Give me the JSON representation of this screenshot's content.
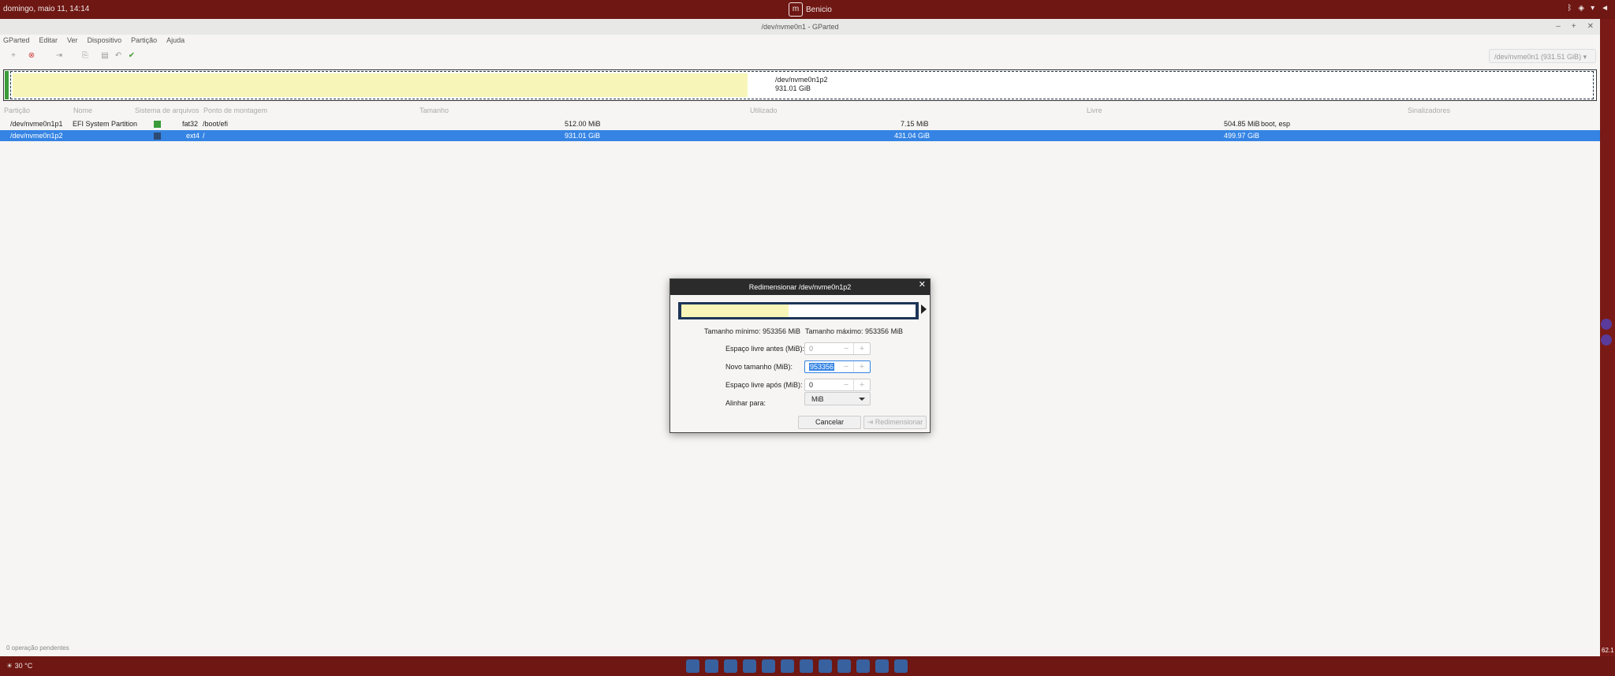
{
  "topbar": {
    "clock": "domingo, maio 11, 14:14",
    "user": "Benicio",
    "icons": [
      "mint-logo-icon",
      "bluetooth-icon",
      "shield-icon",
      "network-icon",
      "volume-icon"
    ]
  },
  "window": {
    "title": "/dev/nvme0n1 - GParted",
    "controls": [
      "minimize-icon",
      "maximize-icon",
      "close-icon"
    ]
  },
  "menu": [
    "GParted",
    "Editar",
    "Ver",
    "Dispositivo",
    "Partição",
    "Ajuda"
  ],
  "toolbar": {
    "icons": [
      "new-icon",
      "delete-icon",
      "resize-icon",
      "copy-icon",
      "paste-icon",
      "undo-icon",
      "apply-icon"
    ],
    "device": "/dev/nvme0n1 (931.51 GiB)"
  },
  "map": {
    "label_name": "/dev/nvme0n1p2",
    "label_size": "931.01 GiB"
  },
  "table": {
    "headers": [
      "Partição",
      "Nome",
      "Sistema de arquivos",
      "Ponto de montagem",
      "Tamanho",
      "Utilizado",
      "Livre",
      "Sinalizadores"
    ],
    "rows": [
      {
        "partition": "/dev/nvme0n1p1",
        "name": "EFI System Partition",
        "fs": "fat32",
        "fs_color": "#3a9b39",
        "mount": "/boot/efi",
        "size": "512.00 MiB",
        "used": "7.15 MiB",
        "free": "504.85 MiB",
        "flags": "boot, esp"
      },
      {
        "partition": "/dev/nvme0n1p2",
        "name": "",
        "fs": "ext4",
        "fs_color": "#2d4a73",
        "mount": "/",
        "size": "931.01 GiB",
        "used": "431.04 GiB",
        "free": "499.97 GiB",
        "flags": ""
      }
    ]
  },
  "status": "0 operação pendentes",
  "dialog": {
    "title": "Redimensionar /dev/nvme0n1p2",
    "min_size": "Tamanho mínimo: 953356 MiB",
    "max_size": "Tamanho máximo: 953356 MiB",
    "free_before_label": "Espaço livre antes (MiB):",
    "free_before_value": "0",
    "new_size_label": "Novo tamanho (MiB):",
    "new_size_value": "953356",
    "free_after_label": "Espaço livre após (MiB):",
    "free_after_value": "0",
    "align_label": "Alinhar para:",
    "align_value": "MiB",
    "cancel": "Cancelar",
    "resize": "Redimensionar"
  },
  "taskbar": {
    "temperature": "30 °C",
    "edge_text": "62.1"
  }
}
